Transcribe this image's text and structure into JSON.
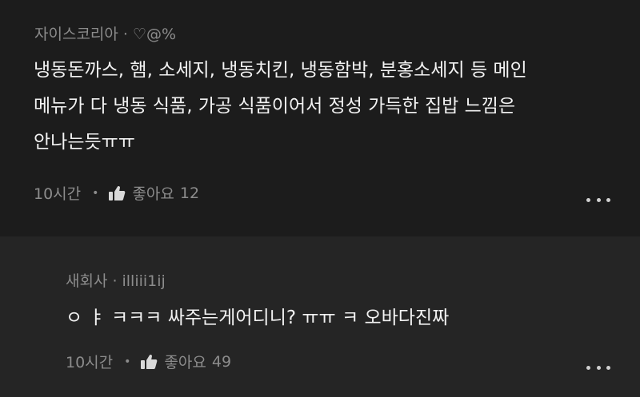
{
  "comments": [
    {
      "author": "자이스코리아",
      "handle": "♡@%",
      "separator": "·",
      "lines": [
        "냉동돈까스, 햄, 소세지, 냉동치킨, 냉동함박, 분홍소세지 등 메인",
        "메뉴가 다 냉동 식품, 가공 식품이어서 정성 가득한 집밥 느낌은",
        "안나는듯ㅠㅠ"
      ],
      "time": "10시간",
      "like_label": "좋아요",
      "like_count": "12",
      "like_icon": "thumbs-up-icon",
      "more_icon": "more-dots-icon"
    },
    {
      "author": "새회사",
      "handle": "illiii1ij",
      "separator": "·",
      "lines": [
        "ㅇ ㅑ ㅋㅋㅋ 싸주는게어디니? ㅠㅠ ㅋ 오바다진짜"
      ],
      "time": "10시간",
      "like_label": "좋아요",
      "like_count": "49",
      "like_icon": "thumbs-up-icon",
      "more_icon": "more-dots-icon"
    }
  ],
  "colors": {
    "background": "#1c1c1c",
    "reply_background": "#252525",
    "text": "#f2f2f2",
    "muted": "#8c8c8c"
  }
}
